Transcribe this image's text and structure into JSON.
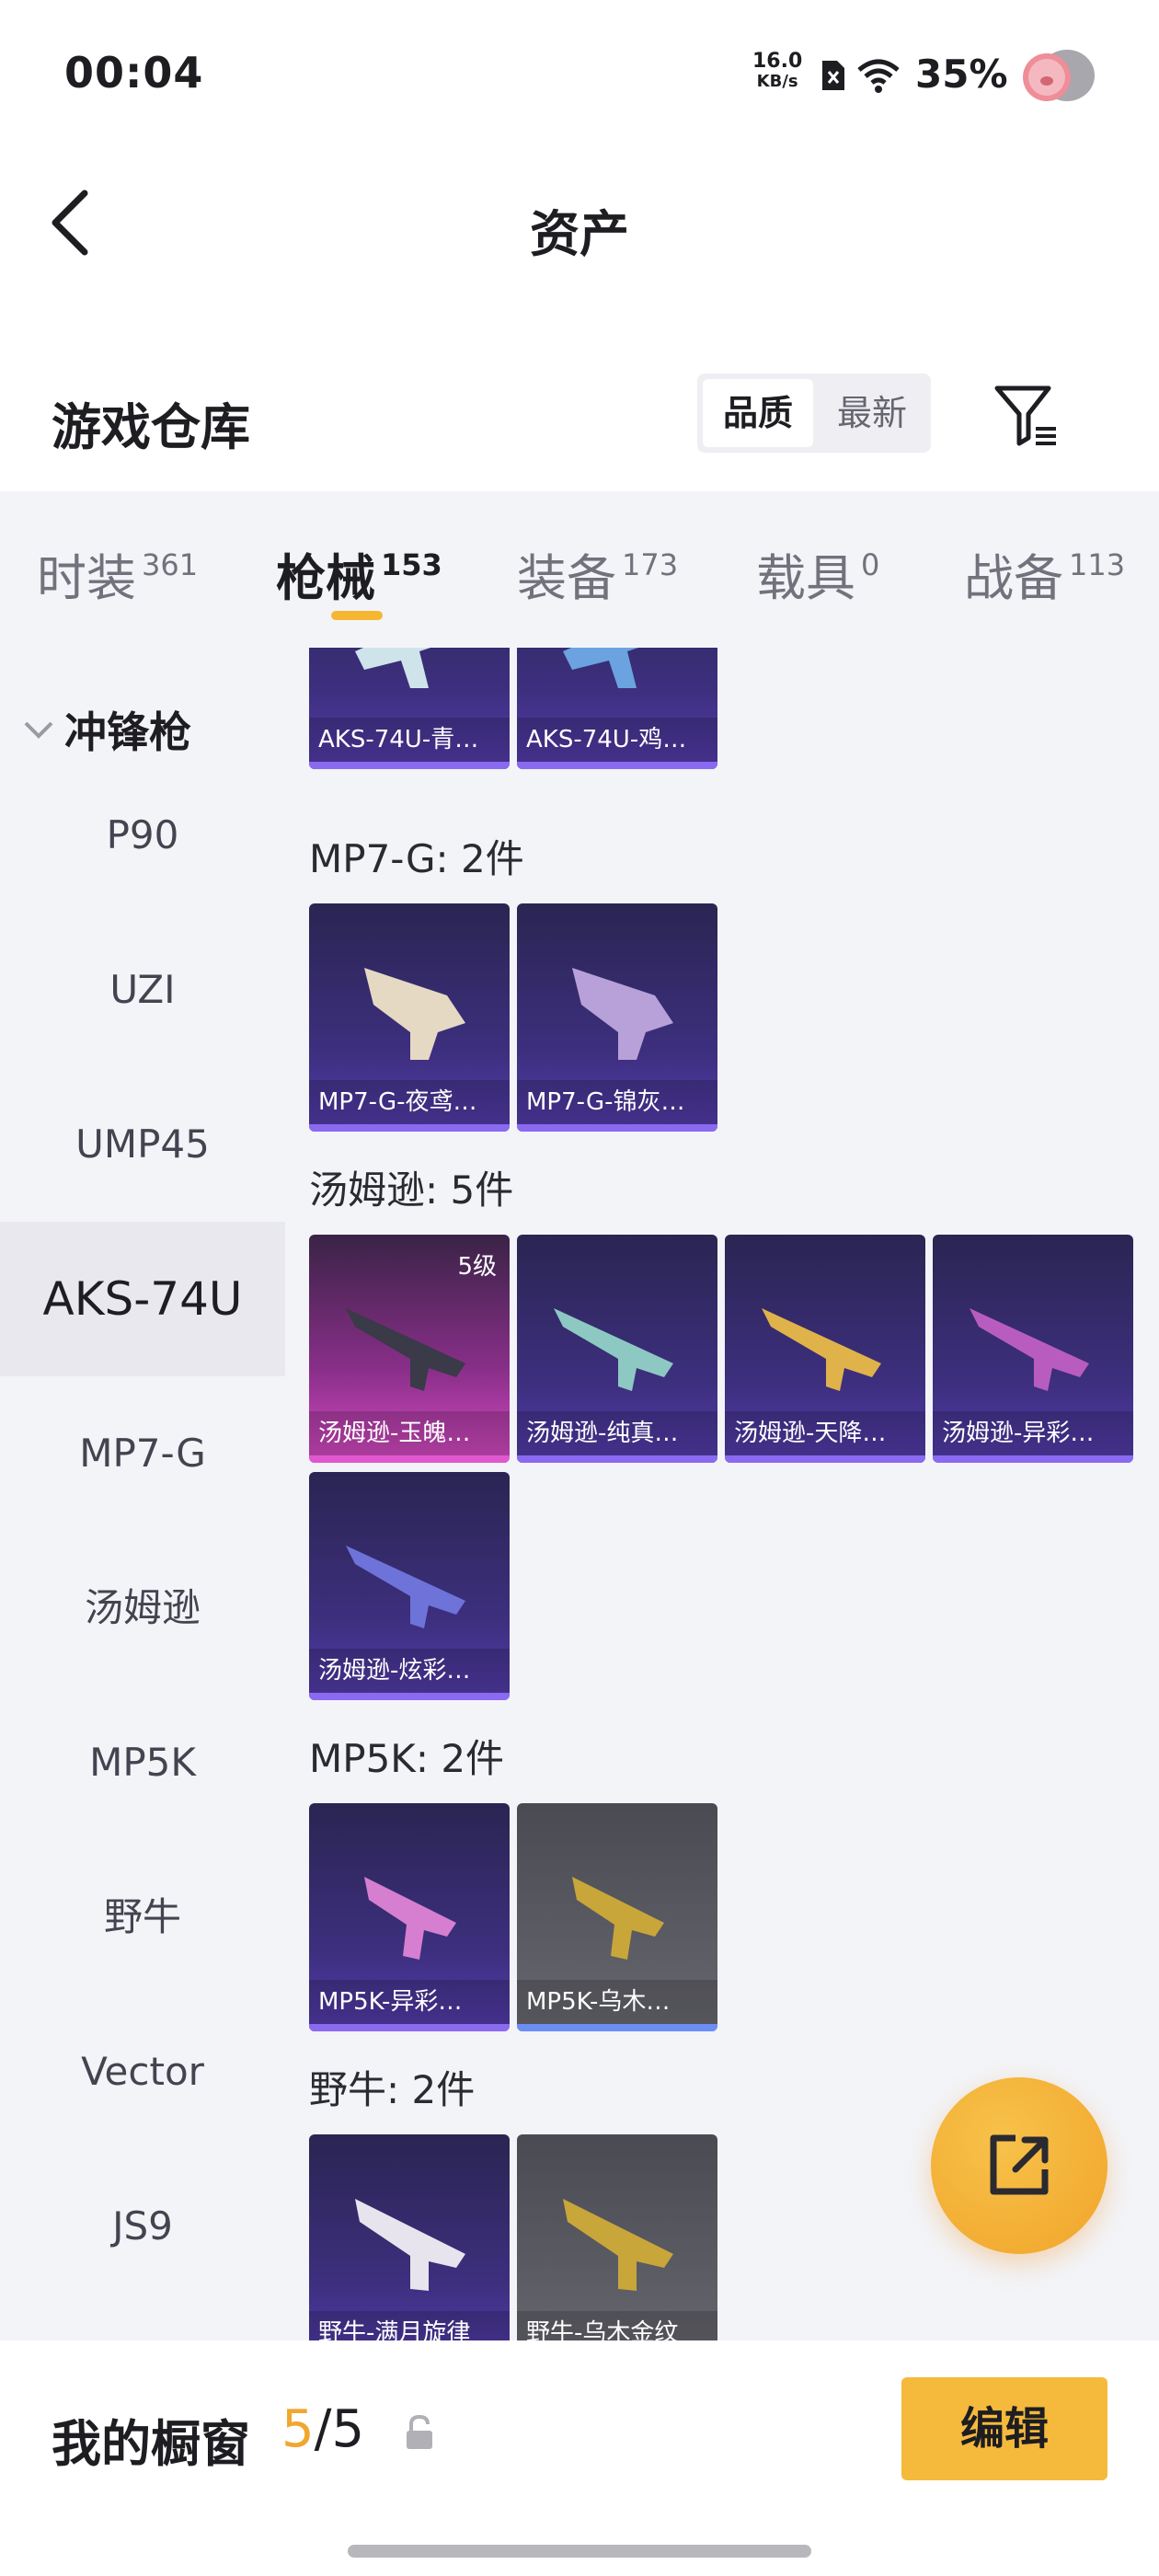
{
  "status_bar": {
    "time": "00:04",
    "net_speed_value": "16.0",
    "net_speed_unit": "KB/s",
    "battery": "35%"
  },
  "header": {
    "title": "资产"
  },
  "warehouse": {
    "title": "游戏仓库",
    "sort_quality": "品质",
    "sort_newest": "最新"
  },
  "tabs": [
    {
      "label": "时装",
      "count": "361"
    },
    {
      "label": "枪械",
      "count": "153"
    },
    {
      "label": "装备",
      "count": "173"
    },
    {
      "label": "载具",
      "count": "0"
    },
    {
      "label": "战备",
      "count": "113"
    }
  ],
  "sidebar": {
    "category": "冲锋枪",
    "items": [
      "P90",
      "UZI",
      "UMP45",
      "AKS-74U",
      "MP7-G",
      "汤姆逊",
      "MP5K",
      "野牛",
      "Vector",
      "JS9"
    ],
    "active": "AKS-74U"
  },
  "content": {
    "partial_group": {
      "items": [
        "AKS-74U-青…",
        "AKS-74U-鸡…"
      ]
    },
    "groups": [
      {
        "label": "MP7-G: 2件",
        "items": [
          "MP7-G-夜鸢…",
          "MP7-G-锦灰…"
        ]
      },
      {
        "label": "汤姆逊: 5件",
        "items": [
          "汤姆逊-玉魄…",
          "汤姆逊-纯真…",
          "汤姆逊-天降…",
          "汤姆逊-异彩…",
          "汤姆逊-炫彩…"
        ],
        "level_badge": "5级"
      },
      {
        "label": "MP5K: 2件",
        "items": [
          "MP5K-异彩…",
          "MP5K-乌木…"
        ]
      },
      {
        "label": "野牛: 2件",
        "items": [
          "野牛-满月旋律",
          "野牛-乌木金纹"
        ]
      }
    ]
  },
  "bottom_bar": {
    "showcase_label": "我的橱窗",
    "showcase_current": "5",
    "showcase_separator": "/",
    "showcase_total": "5",
    "edit_label": "编辑"
  },
  "colors": {
    "accent": "#f5b93c",
    "tab_underline": "#f5b632",
    "card_epic": "#3d2f7e",
    "card_legend": "#d84cc4",
    "card_grey": "#5e5e66"
  },
  "icons": [
    "back-arrow-icon",
    "filter-icon",
    "chevron-down-icon",
    "share-export-icon",
    "lock-icon",
    "wifi-icon",
    "sim-icon"
  ]
}
